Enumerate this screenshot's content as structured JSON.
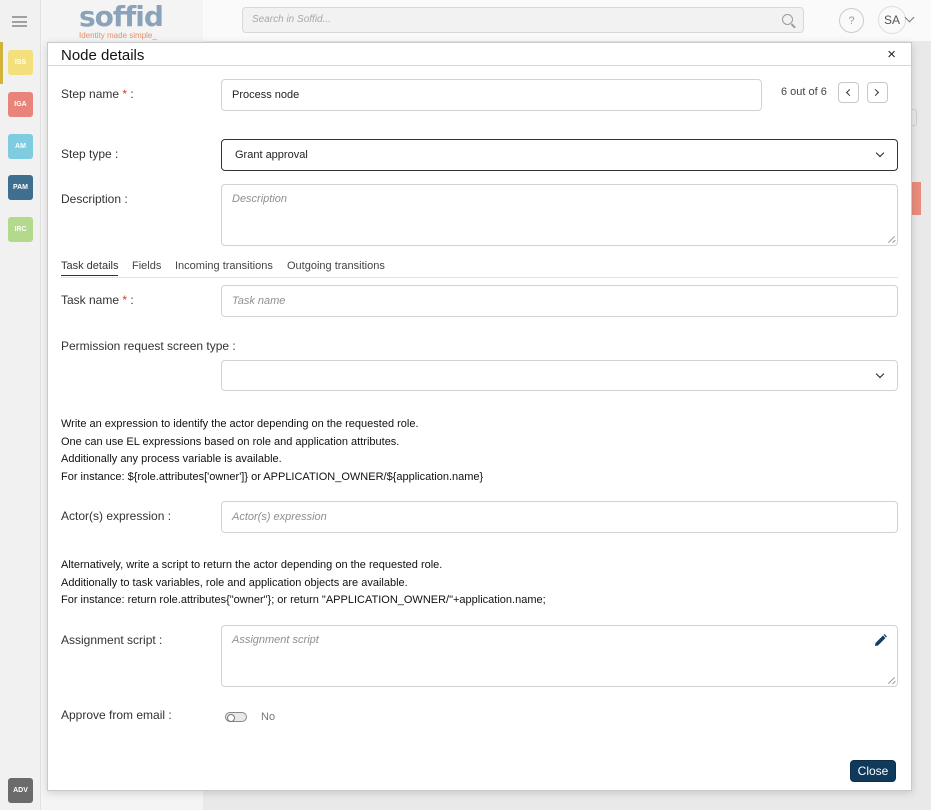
{
  "app": {
    "logo_text": "soffid",
    "tagline": "Identity made simple_",
    "search_placeholder": "Search in Soffid...",
    "help_label": "?",
    "user_initials": "SA",
    "sidebar_apps": [
      {
        "label": "ISS",
        "color": "#f3e07c"
      },
      {
        "label": "IGA",
        "color": "#e8847a"
      },
      {
        "label": "AM",
        "color": "#7fcbe0"
      },
      {
        "label": "PAM",
        "color": "#3f6f8e"
      },
      {
        "label": "IRC",
        "color": "#b2d98c"
      }
    ],
    "adv_label": "ADV"
  },
  "modal": {
    "title": "Node details",
    "close_icon": "×",
    "step_name_label": "Step name",
    "required_mark": "*",
    "colon": " :",
    "step_name_value": "Process node",
    "pager": "6 out of 6",
    "step_type_label": "Step type :",
    "step_type_value": "Grant approval",
    "description_label": "Description :",
    "description_placeholder": "Description",
    "tabs": [
      "Task details",
      "Fields",
      "Incoming transitions",
      "Outgoing transitions"
    ],
    "task_name_label": "Task name",
    "task_name_placeholder": "Task name",
    "permission_label": "Permission request screen type :",
    "permission_value": "",
    "expr_info": [
      "Write an expression to identify the actor depending on the requested role.",
      "One can use EL expressions based on role and application attributes.",
      "Additionally any process variable is available.",
      "For instance: ${role.attributes['owner']} or APPLICATION_OWNER/${application.name}"
    ],
    "actor_label": "Actor(s) expression :",
    "actor_placeholder": "Actor(s) expression",
    "script_info": [
      "Alternatively, write a script to return the actor depending on the requested role.",
      "Additionally to task variables, role and application objects are available.",
      "For instance: return role.attributes{\"owner\"}; or return \"APPLICATION_OWNER/\"+application.name;"
    ],
    "script_label": "Assignment script :",
    "script_placeholder": "Assignment script",
    "approve_label": "Approve from email :",
    "approve_value": "No",
    "close_button": "Close"
  }
}
